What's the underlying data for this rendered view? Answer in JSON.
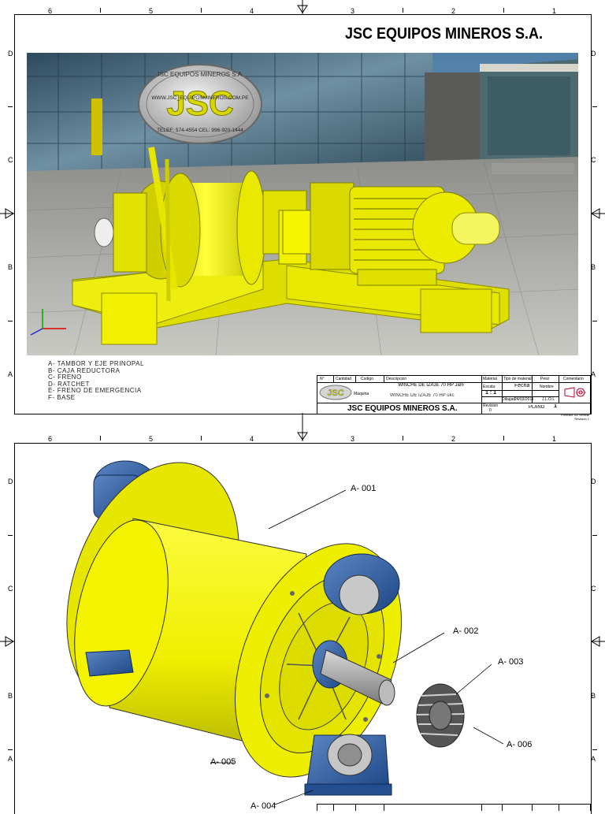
{
  "zones": {
    "columns": [
      "6",
      "5",
      "4",
      "3",
      "2",
      "1"
    ],
    "rows": [
      "D",
      "C",
      "B",
      "A"
    ]
  },
  "sheet1": {
    "title": "JSC EQUIPOS MINEROS S.A.",
    "logo": {
      "letters": "JSC",
      "arc_text": "JSC EQUIPOS MINEROS S.A.",
      "web": "WWW.JSC_EQUIPOSMINEROS.COM.PE",
      "phone": "TELEF: 574-4554   CEL: 996-920-1444"
    },
    "legend": [
      "A- TAMBOR Y EJE PRINOPAL",
      "B- CAJA REDUCTORA",
      "C- FRENO",
      "D- RATCHET",
      "E- FRENO DE EMERGENCIA",
      "F- BASE"
    ],
    "title_block": {
      "headers": [
        "N°",
        "Cantidad",
        "Codigo",
        "Descripcion",
        "Material",
        "Tipo de material",
        "Peso",
        "Comentario"
      ],
      "description": "WINCHE DE IZAJE 70 HP Jam",
      "equipment_label": "Maquina",
      "equipment_value": "WINCHE DE IZAJE 70 HP ukc",
      "scale_label": "Escala:",
      "scale_value": "1 : 1",
      "date_label": "Fecha",
      "name_label": "Nombre",
      "drawn_label": "Dibujad",
      "drawn_date": "24/03/2011",
      "drawn_name": "J.L.O.L",
      "revision_label": "Revision",
      "revision_value": "0",
      "plano_label": "PLANO",
      "plano_value": "1",
      "company": "JSC EQUIPOS MINEROS S.A.",
      "footnote1": "Formato: A4 Vertical",
      "footnote2": "Revision 1"
    }
  },
  "sheet2": {
    "callouts": [
      "A- 001",
      "A- 002",
      "A- 003",
      "A- 004",
      "A- 005",
      "A- 006"
    ]
  },
  "colors": {
    "machine_yellow": "#f2f200",
    "bearing_blue": "#2c5aa0",
    "steel_gray": "#9a9a9a"
  }
}
